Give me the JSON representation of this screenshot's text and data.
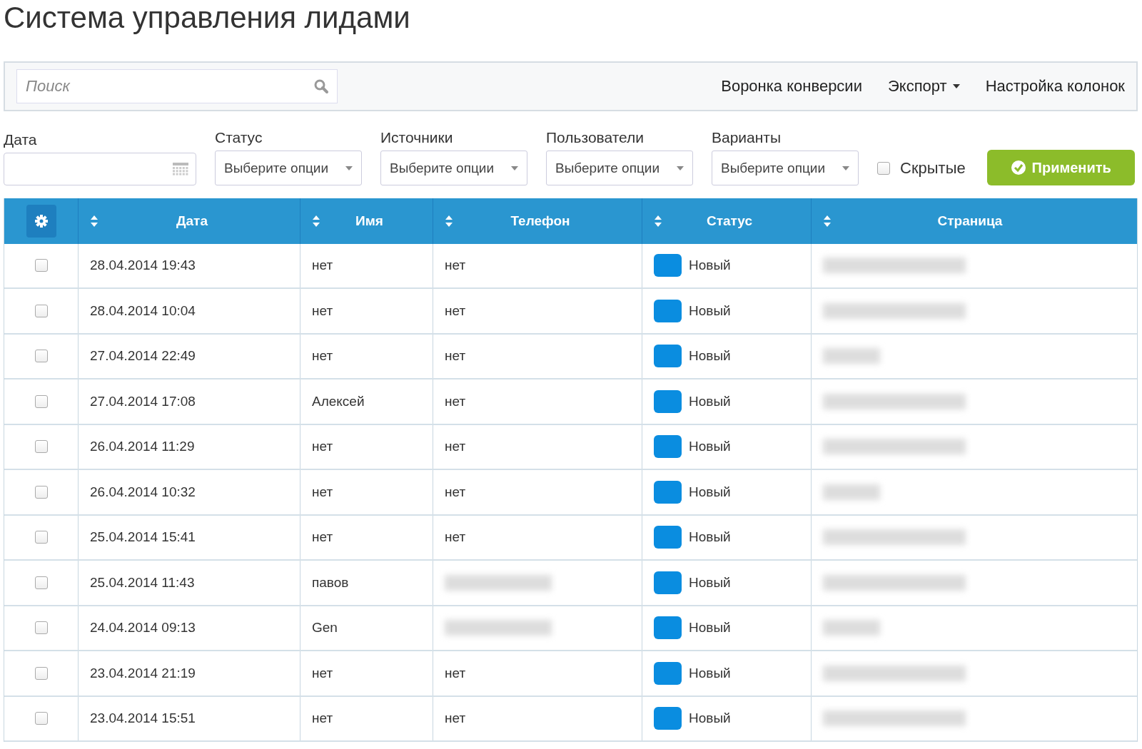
{
  "title": "Система управления лидами",
  "toolbar": {
    "search": {
      "placeholder": "Поиск"
    },
    "links": [
      {
        "label": "Воронка конверсии",
        "dropdown": false
      },
      {
        "label": "Экспорт",
        "dropdown": true
      },
      {
        "label": "Настройка колонок",
        "dropdown": false
      }
    ]
  },
  "filters": {
    "date": {
      "label": "Дата"
    },
    "selects": [
      {
        "label": "Статус",
        "placeholder": "Выберите опции"
      },
      {
        "label": "Источники",
        "placeholder": "Выберите опции"
      },
      {
        "label": "Пользователи",
        "placeholder": "Выберите опции"
      },
      {
        "label": "Варианты",
        "placeholder": "Выберите опции"
      }
    ],
    "hidden": {
      "label": "Скрытые",
      "checked": false
    },
    "apply": "Применить"
  },
  "table": {
    "columns": [
      "Дата",
      "Имя",
      "Телефон",
      "Статус",
      "Страница"
    ],
    "rows": [
      {
        "checked": false,
        "date": "28.04.2014 19:43",
        "name": "нет",
        "phone": "нет",
        "status": "Новый",
        "color": "#0a8de0",
        "page_blurred": true
      },
      {
        "checked": false,
        "date": "28.04.2014 10:04",
        "name": "нет",
        "phone": "нет",
        "status": "Новый",
        "color": "#0a8de0",
        "page_blurred": true
      },
      {
        "checked": false,
        "date": "27.04.2014 22:49",
        "name": "нет",
        "phone": "нет",
        "status": "Новый",
        "color": "#0a8de0",
        "page_blurred": true
      },
      {
        "checked": false,
        "date": "27.04.2014 17:08",
        "name": "Алексей",
        "phone": "нет",
        "status": "Новый",
        "color": "#0a8de0",
        "page_blurred": true
      },
      {
        "checked": false,
        "date": "26.04.2014 11:29",
        "name": "нет",
        "phone": "нет",
        "status": "Новый",
        "color": "#0a8de0",
        "page_blurred": true
      },
      {
        "checked": false,
        "date": "26.04.2014 10:32",
        "name": "нет",
        "phone": "нет",
        "status": "Новый",
        "color": "#0a8de0",
        "page_blurred": true
      },
      {
        "checked": false,
        "date": "25.04.2014 15:41",
        "name": "нет",
        "phone": "нет",
        "status": "Новый",
        "color": "#0a8de0",
        "page_blurred": true
      },
      {
        "checked": false,
        "date": "25.04.2014 11:43",
        "name": "павов",
        "phone_blurred": true,
        "status": "Новый",
        "color": "#0a8de0",
        "page_blurred": true
      },
      {
        "checked": false,
        "date": "24.04.2014 09:13",
        "name": "Gen",
        "phone_blurred": true,
        "status": "Новый",
        "color": "#0a8de0",
        "page_blurred": true
      },
      {
        "checked": false,
        "date": "23.04.2014 21:19",
        "name": "нет",
        "phone": "нет",
        "status": "Новый",
        "color": "#0a8de0",
        "page_blurred": true
      },
      {
        "checked": false,
        "date": "23.04.2014 15:51",
        "name": "нет",
        "phone": "нет",
        "status": "Новый",
        "color": "#0a8de0",
        "page_blurred": true
      }
    ]
  }
}
